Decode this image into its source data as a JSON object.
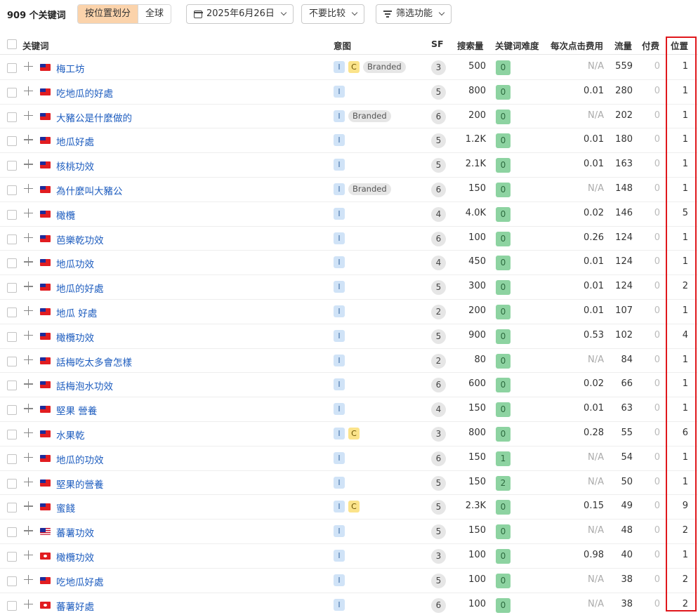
{
  "toolbar": {
    "count": "909 个关键词",
    "seg_active": "按位置划分",
    "seg_inactive": "全球",
    "date": "2025年6月26日",
    "compare": "不要比较",
    "filter": "筛选功能"
  },
  "columns": {
    "keyword": "关键词",
    "intent": "意图",
    "sf": "SF",
    "volume": "搜索量",
    "kd": "关键词难度",
    "cpc": "每次点击费用",
    "traffic": "流量",
    "paid": "付费",
    "position": "位置"
  },
  "rows": [
    {
      "flag": "tw",
      "kw": "梅工坊",
      "intent": [
        "I",
        "C",
        "Branded"
      ],
      "sf": "3",
      "vol": "500",
      "kd": "0",
      "cpc": "N/A",
      "traffic": "559",
      "paid": "0",
      "pos": "1"
    },
    {
      "flag": "tw",
      "kw": "吃地瓜的好處",
      "intent": [
        "I"
      ],
      "sf": "5",
      "vol": "800",
      "kd": "0",
      "cpc": "0.01",
      "traffic": "280",
      "paid": "0",
      "pos": "1"
    },
    {
      "flag": "tw",
      "kw": "大豬公是什麼做的",
      "intent": [
        "I",
        "Branded"
      ],
      "sf": "6",
      "vol": "200",
      "kd": "0",
      "cpc": "N/A",
      "traffic": "202",
      "paid": "0",
      "pos": "1"
    },
    {
      "flag": "tw",
      "kw": "地瓜好處",
      "intent": [
        "I"
      ],
      "sf": "5",
      "vol": "1.2K",
      "kd": "0",
      "cpc": "0.01",
      "traffic": "180",
      "paid": "0",
      "pos": "1"
    },
    {
      "flag": "tw",
      "kw": "核桃功效",
      "intent": [
        "I"
      ],
      "sf": "5",
      "vol": "2.1K",
      "kd": "0",
      "cpc": "0.01",
      "traffic": "163",
      "paid": "0",
      "pos": "1"
    },
    {
      "flag": "tw",
      "kw": "為什麼叫大豬公",
      "intent": [
        "I",
        "Branded"
      ],
      "sf": "6",
      "vol": "150",
      "kd": "0",
      "cpc": "N/A",
      "traffic": "148",
      "paid": "0",
      "pos": "1"
    },
    {
      "flag": "tw",
      "kw": "橄欖",
      "intent": [
        "I"
      ],
      "sf": "4",
      "vol": "4.0K",
      "kd": "0",
      "cpc": "0.02",
      "traffic": "146",
      "paid": "0",
      "pos": "5"
    },
    {
      "flag": "tw",
      "kw": "芭樂乾功效",
      "intent": [
        "I"
      ],
      "sf": "6",
      "vol": "100",
      "kd": "0",
      "cpc": "0.26",
      "traffic": "124",
      "paid": "0",
      "pos": "1"
    },
    {
      "flag": "tw",
      "kw": "地瓜功效",
      "intent": [
        "I"
      ],
      "sf": "4",
      "vol": "450",
      "kd": "0",
      "cpc": "0.01",
      "traffic": "124",
      "paid": "0",
      "pos": "1"
    },
    {
      "flag": "tw",
      "kw": "地瓜的好處",
      "intent": [
        "I"
      ],
      "sf": "5",
      "vol": "300",
      "kd": "0",
      "cpc": "0.01",
      "traffic": "124",
      "paid": "0",
      "pos": "2"
    },
    {
      "flag": "tw",
      "kw": "地瓜 好處",
      "intent": [
        "I"
      ],
      "sf": "2",
      "vol": "200",
      "kd": "0",
      "cpc": "0.01",
      "traffic": "107",
      "paid": "0",
      "pos": "1"
    },
    {
      "flag": "tw",
      "kw": "橄欖功效",
      "intent": [
        "I"
      ],
      "sf": "5",
      "vol": "900",
      "kd": "0",
      "cpc": "0.53",
      "traffic": "102",
      "paid": "0",
      "pos": "4"
    },
    {
      "flag": "tw",
      "kw": "話梅吃太多會怎樣",
      "intent": [
        "I"
      ],
      "sf": "2",
      "vol": "80",
      "kd": "0",
      "cpc": "N/A",
      "traffic": "84",
      "paid": "0",
      "pos": "1"
    },
    {
      "flag": "tw",
      "kw": "話梅泡水功效",
      "intent": [
        "I"
      ],
      "sf": "6",
      "vol": "600",
      "kd": "0",
      "cpc": "0.02",
      "traffic": "66",
      "paid": "0",
      "pos": "1"
    },
    {
      "flag": "tw",
      "kw": "堅果 營養",
      "intent": [
        "I"
      ],
      "sf": "4",
      "vol": "150",
      "kd": "0",
      "cpc": "0.01",
      "traffic": "63",
      "paid": "0",
      "pos": "1"
    },
    {
      "flag": "tw",
      "kw": "水果乾",
      "intent": [
        "I",
        "C"
      ],
      "sf": "3",
      "vol": "800",
      "kd": "0",
      "cpc": "0.28",
      "traffic": "55",
      "paid": "0",
      "pos": "6"
    },
    {
      "flag": "tw",
      "kw": "地瓜的功效",
      "intent": [
        "I"
      ],
      "sf": "6",
      "vol": "150",
      "kd": "1",
      "cpc": "N/A",
      "traffic": "54",
      "paid": "0",
      "pos": "1"
    },
    {
      "flag": "tw",
      "kw": "堅果的營養",
      "intent": [
        "I"
      ],
      "sf": "5",
      "vol": "150",
      "kd": "2",
      "cpc": "N/A",
      "traffic": "50",
      "paid": "0",
      "pos": "1"
    },
    {
      "flag": "tw",
      "kw": "蜜餞",
      "intent": [
        "I",
        "C"
      ],
      "sf": "5",
      "vol": "2.3K",
      "kd": "0",
      "cpc": "0.15",
      "traffic": "49",
      "paid": "0",
      "pos": "9"
    },
    {
      "flag": "my",
      "kw": "蕃薯功效",
      "intent": [
        "I"
      ],
      "sf": "5",
      "vol": "150",
      "kd": "0",
      "cpc": "N/A",
      "traffic": "48",
      "paid": "0",
      "pos": "2"
    },
    {
      "flag": "hk",
      "kw": "橄欖功效",
      "intent": [
        "I"
      ],
      "sf": "3",
      "vol": "100",
      "kd": "0",
      "cpc": "0.98",
      "traffic": "40",
      "paid": "0",
      "pos": "1"
    },
    {
      "flag": "tw",
      "kw": "吃地瓜好處",
      "intent": [
        "I"
      ],
      "sf": "5",
      "vol": "100",
      "kd": "0",
      "cpc": "N/A",
      "traffic": "38",
      "paid": "0",
      "pos": "2"
    },
    {
      "flag": "hk",
      "kw": "蕃薯好處",
      "intent": [
        "I"
      ],
      "sf": "6",
      "vol": "100",
      "kd": "0",
      "cpc": "N/A",
      "traffic": "38",
      "paid": "0",
      "pos": "2"
    }
  ]
}
